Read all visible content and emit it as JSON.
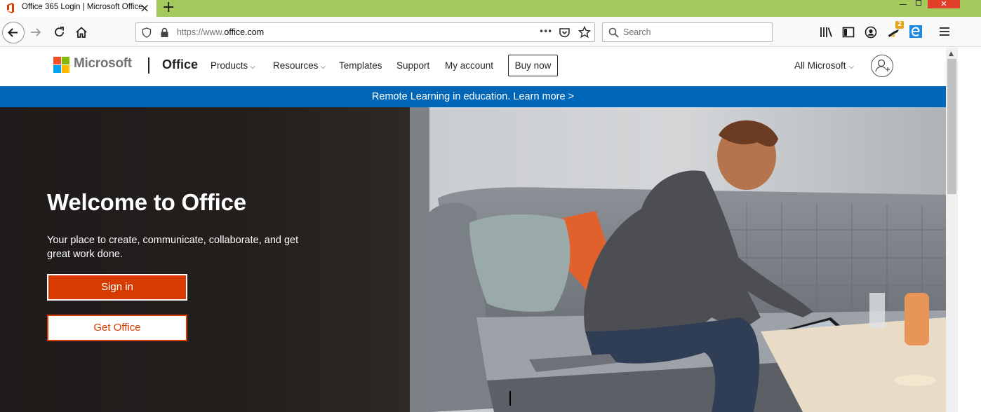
{
  "browser": {
    "tab_title": "Office 365 Login | Microsoft Office",
    "tab_close": "×",
    "new_tab": "+",
    "url_prefix": "https://www.",
    "url_domain": "office.com",
    "search_placeholder": "Search",
    "page_actions": "•••",
    "extension_badge": "2",
    "window_close": "✕"
  },
  "header": {
    "brand": "Microsoft",
    "product": "Office",
    "nav": [
      "Products",
      "Resources",
      "Templates",
      "Support",
      "My account"
    ],
    "chevron": "⌵",
    "buy_button": "Buy now",
    "all_microsoft": "All Microsoft"
  },
  "banner": {
    "text": "Remote Learning in education. Learn more >"
  },
  "hero": {
    "title": "Welcome to Office",
    "subtitle": "Your place to create, communicate, collaborate, and get great work done.",
    "sign_in": "Sign in",
    "get_office": "Get Office"
  },
  "colors": {
    "titlebar": "#a4c95c",
    "ms_red": "#f25022",
    "ms_green": "#7fba00",
    "ms_blue": "#00a4ef",
    "ms_yellow": "#ffb900",
    "banner_blue": "#0067b8",
    "office_orange": "#d83b01"
  }
}
